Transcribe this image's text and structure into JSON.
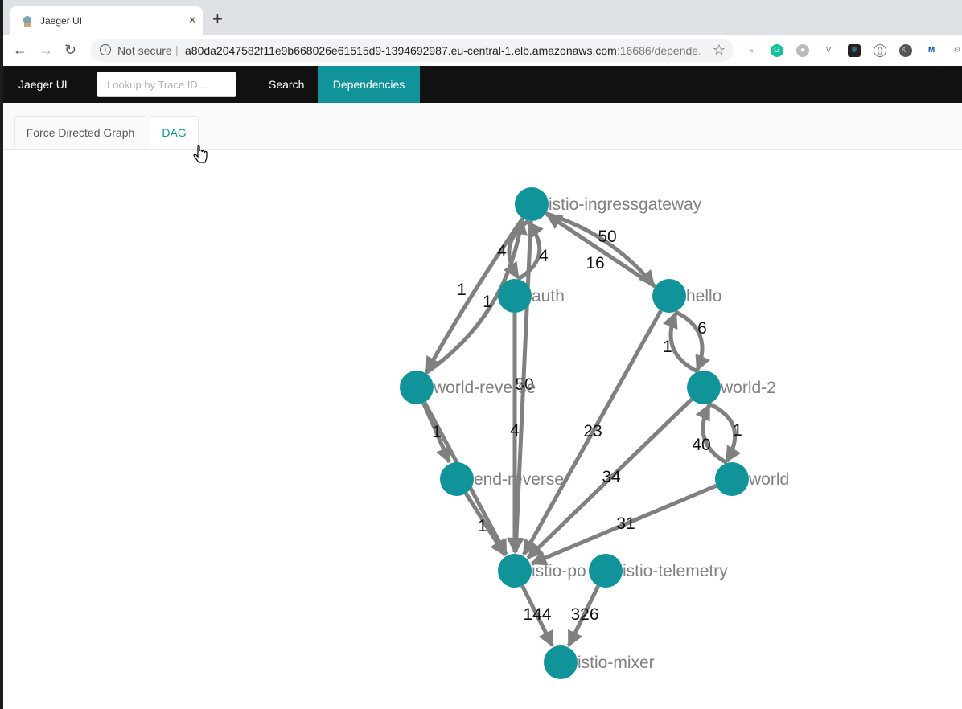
{
  "browser": {
    "tab_title": "Jaeger UI",
    "close_glyph": "×",
    "new_tab_glyph": "+",
    "security_label": "Not secure",
    "url_host": "a80da2047582f11e9b668026e61515d9-1394692987.eu-central-1.elb.amazonaws.com",
    "url_rest": ":16686/depende...",
    "extensions": [
      "wave-icon",
      "grammarly-icon",
      "circle-ext-icon",
      "v-ext-icon",
      "react-devtools-icon",
      "bracket-ext-icon",
      "moon-ext-icon",
      "m-ext-icon",
      "settings-ext-icon"
    ]
  },
  "jaeger_nav": {
    "brand": "Jaeger UI",
    "lookup_placeholder": "Lookup by Trace ID...",
    "search_label": "Search",
    "dependencies_label": "Dependencies"
  },
  "subtabs": {
    "force_directed": "Force Directed Graph",
    "dag": "DAG",
    "active": "DAG"
  },
  "colors": {
    "accent": "#11939a",
    "node": "#11939a",
    "edge": "#808080",
    "nav_bg": "#111111"
  },
  "dag": {
    "nodes": [
      {
        "id": "istio-ingressgateway",
        "label": "istio-ingressgateway"
      },
      {
        "id": "auth",
        "label": "auth"
      },
      {
        "id": "hello",
        "label": "hello"
      },
      {
        "id": "world-reverse",
        "label": "world-reverse"
      },
      {
        "id": "world-2",
        "label": "world-2"
      },
      {
        "id": "end-reverse",
        "label": "end-reverse"
      },
      {
        "id": "world",
        "label": "world"
      },
      {
        "id": "istio-policy",
        "label": "istio-po"
      },
      {
        "id": "istio-telemetry",
        "label": "istio-telemetry"
      },
      {
        "id": "istio-mixer",
        "label": "istio-mixer"
      }
    ],
    "edges": [
      {
        "from": "istio-ingressgateway",
        "to": "hello",
        "label": "50"
      },
      {
        "from": "hello",
        "to": "istio-ingressgateway",
        "label": "16"
      },
      {
        "from": "auth",
        "to": "istio-ingressgateway",
        "label": "4"
      },
      {
        "from": "istio-ingressgateway",
        "to": "auth",
        "label": "4"
      },
      {
        "from": "world-reverse",
        "to": "istio-ingressgateway",
        "label": "1"
      },
      {
        "from": "istio-ingressgateway",
        "to": "world-reverse",
        "label": "1"
      },
      {
        "from": "istio-ingressgateway",
        "to": "istio-policy",
        "label": "50"
      },
      {
        "from": "hello",
        "to": "world-2",
        "label": "6"
      },
      {
        "from": "world-2",
        "to": "hello",
        "label": "1"
      },
      {
        "from": "world-reverse",
        "to": "end-reverse",
        "label": "1"
      },
      {
        "from": "auth",
        "to": "istio-policy",
        "label": "4"
      },
      {
        "from": "hello",
        "to": "istio-policy",
        "label": "23"
      },
      {
        "from": "world-2",
        "to": "istio-policy",
        "label": "34"
      },
      {
        "from": "world-2",
        "to": "world",
        "label": "1"
      },
      {
        "from": "world",
        "to": "world-2",
        "label": "40"
      },
      {
        "from": "world",
        "to": "istio-policy",
        "label": "31"
      },
      {
        "from": "end-reverse",
        "to": "istio-policy",
        "label": "1"
      },
      {
        "from": "world-reverse",
        "to": "istio-policy",
        "label": ""
      },
      {
        "from": "istio-policy",
        "to": "istio-mixer",
        "label": "144"
      },
      {
        "from": "istio-telemetry",
        "to": "istio-mixer",
        "label": "326"
      }
    ]
  }
}
